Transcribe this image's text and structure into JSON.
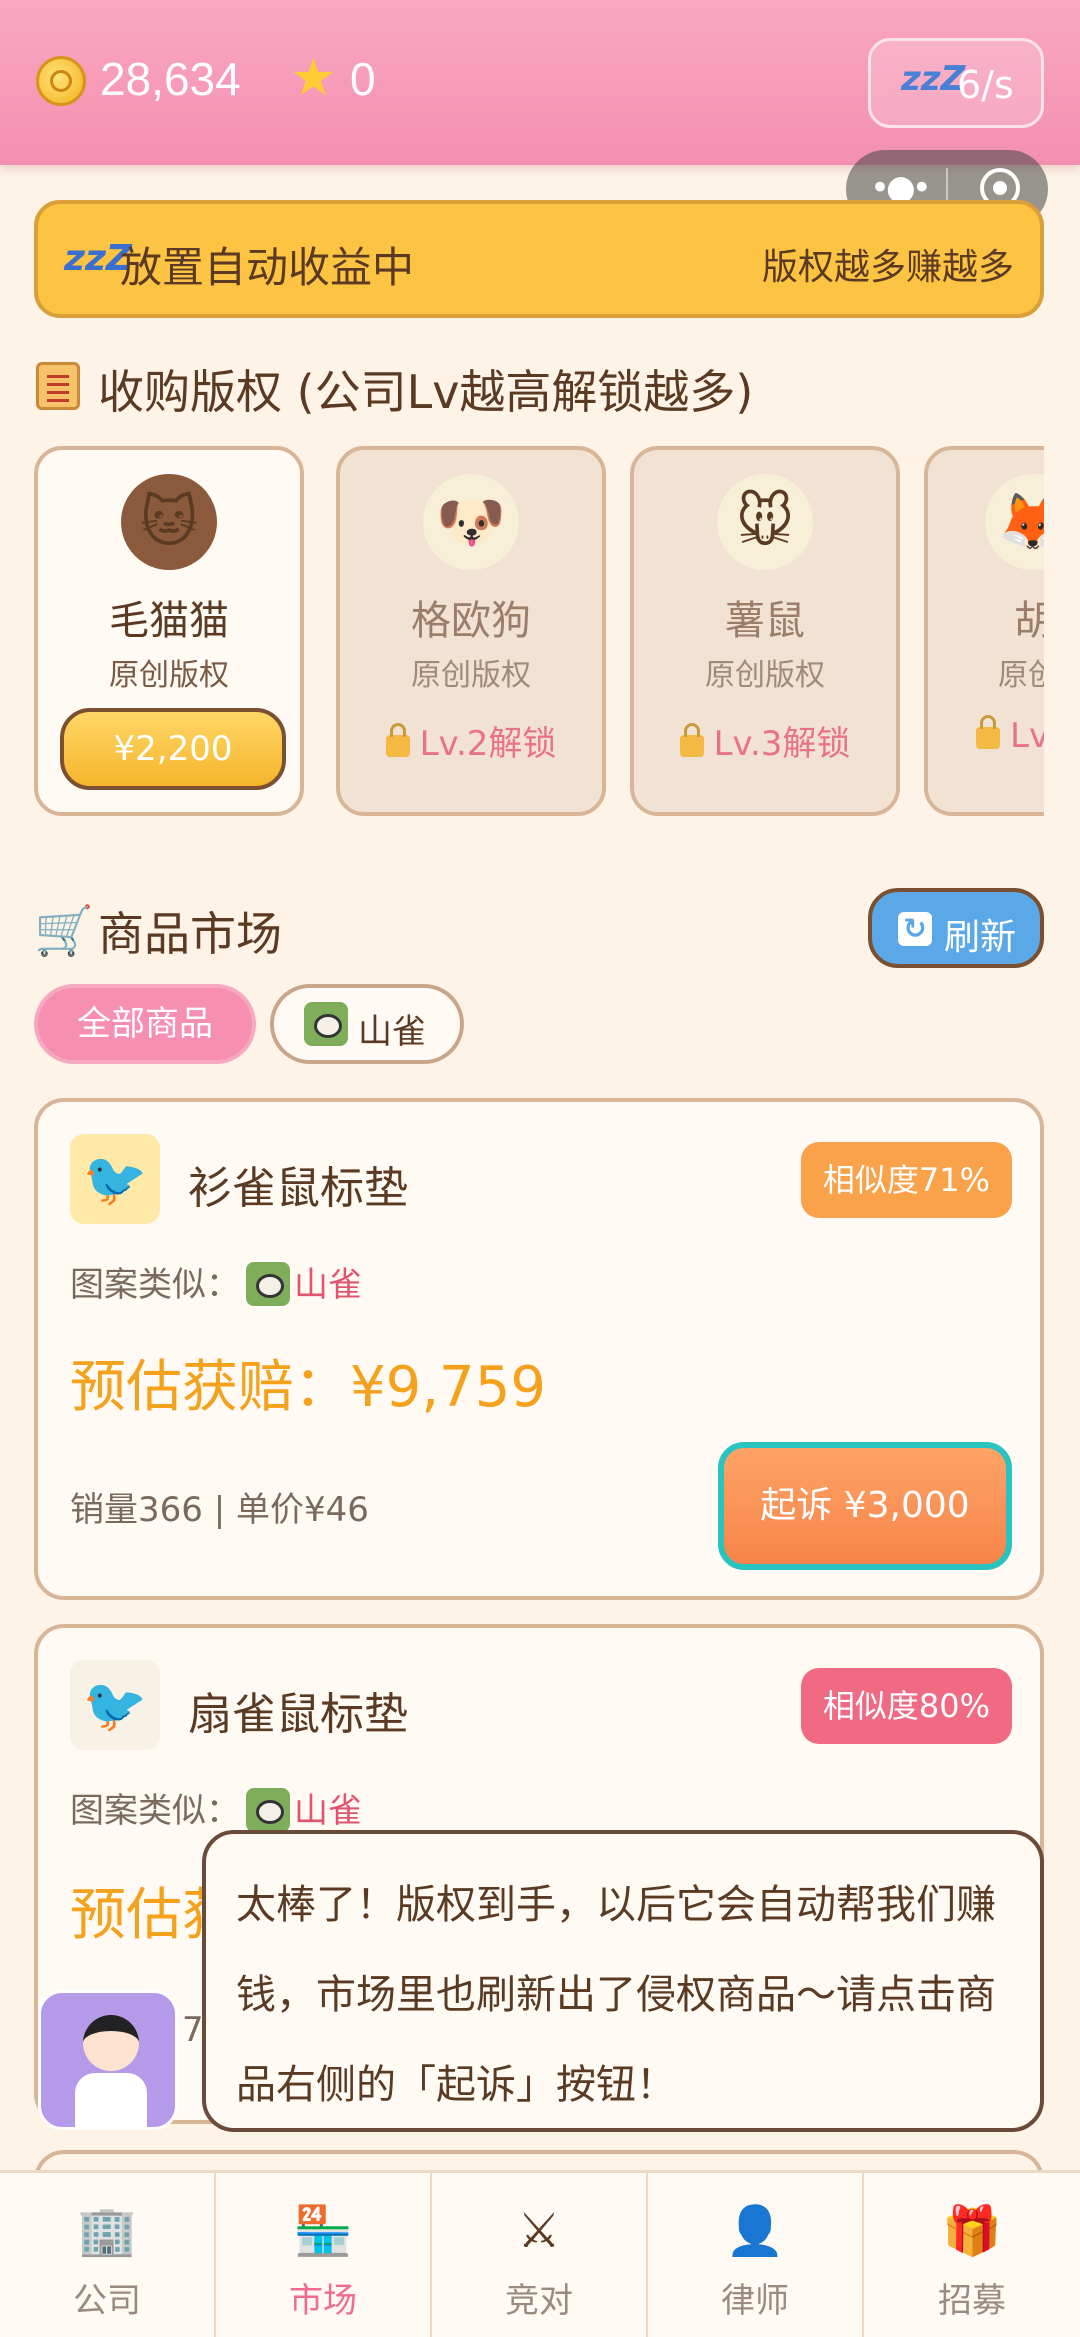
{
  "header": {
    "coins": "28,634",
    "stars": "0",
    "rate": "6/s"
  },
  "banner": {
    "title": "放置自动收益中",
    "right": "版权越多赚越多"
  },
  "copyright_section": {
    "title": "收购版权 (公司Lv越高解锁越多)",
    "cards": [
      {
        "name": "毛猫猫",
        "sub": "原创版权",
        "price": "¥2,200",
        "icon": "cat-icon"
      },
      {
        "name": "格欧狗",
        "sub": "原创版权",
        "lock": "Lv.2解锁",
        "icon": "dog-icon"
      },
      {
        "name": "薯鼠",
        "sub": "原创版权",
        "lock": "Lv.3解锁",
        "icon": "mouse-icon"
      },
      {
        "name": "胡",
        "sub": "原创",
        "lock": "Lv",
        "icon": "fox-icon"
      }
    ]
  },
  "market": {
    "title": "商品市场",
    "refresh": "刷新",
    "filters": {
      "all": "全部商品",
      "bird": "山雀"
    },
    "products": [
      {
        "name": "衫雀鼠标垫",
        "similarity": "相似度71%",
        "similarity_color": "#f9a24a",
        "pattern_label": "图案类似：",
        "pattern_name": "山雀",
        "estimate": "预估获赔：¥9,759",
        "sales": "销量366 | 单价¥46",
        "sue": "起诉 ¥3,000"
      },
      {
        "name": "扇雀鼠标垫",
        "similarity": "相似度80%",
        "similarity_color": "#f06a84",
        "pattern_label": "图案类似：",
        "pattern_name": "山雀",
        "estimate_partial": "预估获",
        "sales_partial": "7"
      }
    ]
  },
  "guide": {
    "message": "太棒了！版权到手，以后它会自动帮我们赚钱，市场里也刷新出了侵权商品～请点击商品右侧的「起诉」按钮！"
  },
  "nav": [
    {
      "label": "公司",
      "icon": "company-icon"
    },
    {
      "label": "市场",
      "icon": "market-icon",
      "active": true
    },
    {
      "label": "竞对",
      "icon": "swords-icon"
    },
    {
      "label": "律师",
      "icon": "lawyer-icon"
    },
    {
      "label": "招募",
      "icon": "gift-icon"
    }
  ]
}
